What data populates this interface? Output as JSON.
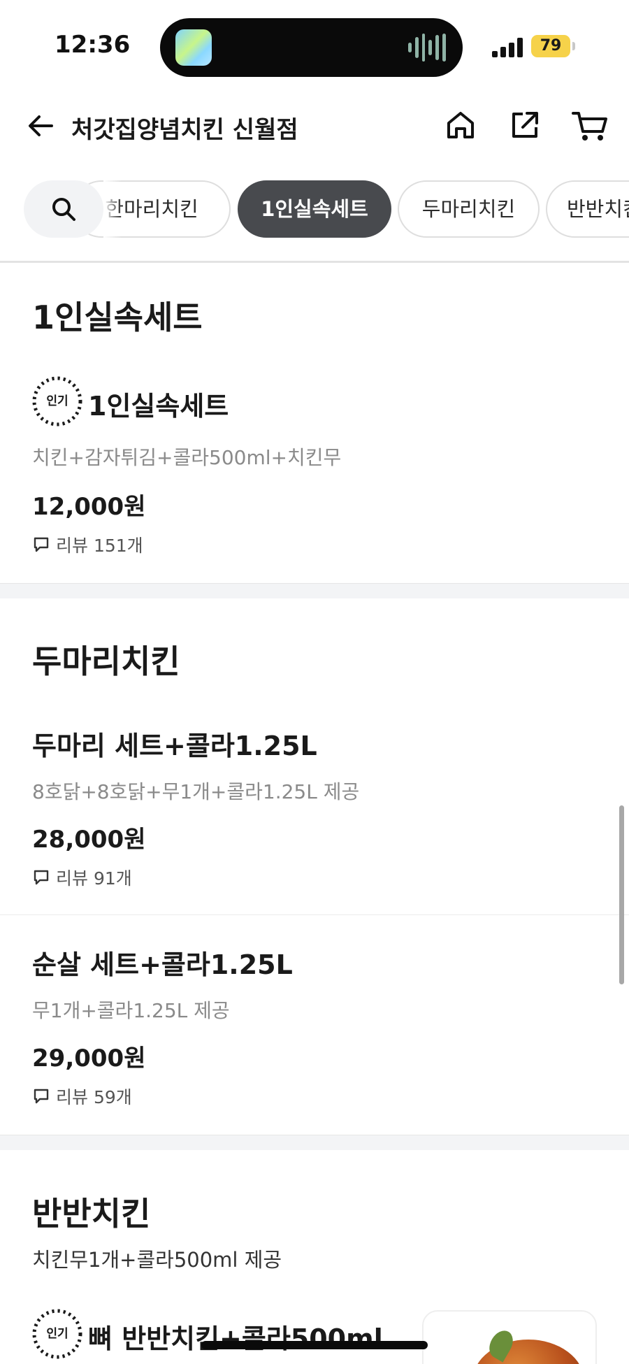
{
  "status_bar": {
    "time": "12:36",
    "battery": "79"
  },
  "header": {
    "title": "처갓집양념치킨 신월점"
  },
  "categories": {
    "chips": [
      {
        "label": "한마리치킨",
        "active": false
      },
      {
        "label": "1인실속세트",
        "active": true
      },
      {
        "label": "두마리치킨",
        "active": false
      },
      {
        "label": "반반치킨",
        "active": false
      }
    ]
  },
  "sections": [
    {
      "title": "1인실속세트",
      "items": [
        {
          "badge": "인기",
          "name": "1인실속세트",
          "desc": "치킨+감자튀김+콜라500ml+치킨무",
          "price": "12,000원",
          "review": "리뷰 151개"
        }
      ]
    },
    {
      "title": "두마리치킨",
      "items": [
        {
          "name": "두마리 세트+콜라1.25L",
          "desc": "8호닭+8호닭+무1개+콜라1.25L 제공",
          "price": "28,000원",
          "review": "리뷰 91개"
        },
        {
          "name": "순살 세트+콜라1.25L",
          "desc": "무1개+콜라1.25L 제공",
          "price": "29,000원",
          "review": "리뷰 59개"
        }
      ]
    },
    {
      "title": "반반치킨",
      "subtitle": "치킨무1개+콜라500ml 제공",
      "items": [
        {
          "badge": "인기",
          "name": "뼈 반반치킨+콜라500ml"
        }
      ]
    }
  ],
  "colors": {
    "active_chip": "#484a4e",
    "battery": "#f6d24a",
    "muted_text": "#8a8a8a"
  }
}
